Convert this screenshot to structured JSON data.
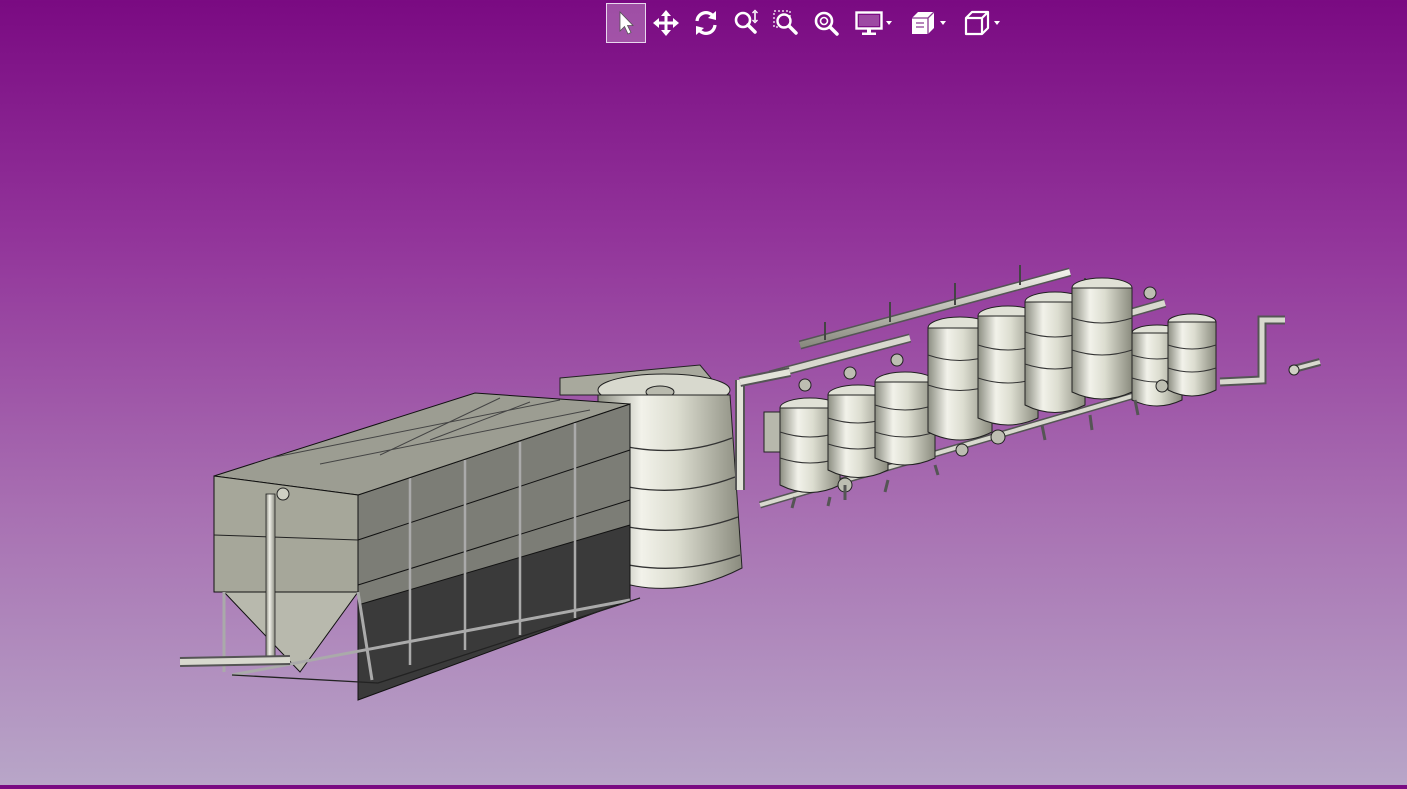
{
  "toolbar": {
    "buttons": [
      {
        "id": "select",
        "icon": "arrow-pointer-icon",
        "selected": true
      },
      {
        "id": "pan",
        "icon": "move-arrows-icon"
      },
      {
        "id": "rotate",
        "icon": "rotate-icon"
      },
      {
        "id": "zoom",
        "icon": "zoom-updown-icon"
      },
      {
        "id": "zoom-window",
        "icon": "zoom-window-icon"
      },
      {
        "id": "zoom-fit",
        "icon": "zoom-fit-icon"
      },
      {
        "id": "display",
        "icon": "monitor-icon",
        "dropdown": true
      },
      {
        "id": "section",
        "icon": "section-cube-icon",
        "dropdown": true
      },
      {
        "id": "view",
        "icon": "cube-view-icon",
        "dropdown": true
      }
    ]
  },
  "viewport": {
    "background_top": "#7a0a82",
    "background_bottom": "#b8a6c8",
    "model_color": "#b0b2a2",
    "model_dark": "#3a3a3a"
  }
}
